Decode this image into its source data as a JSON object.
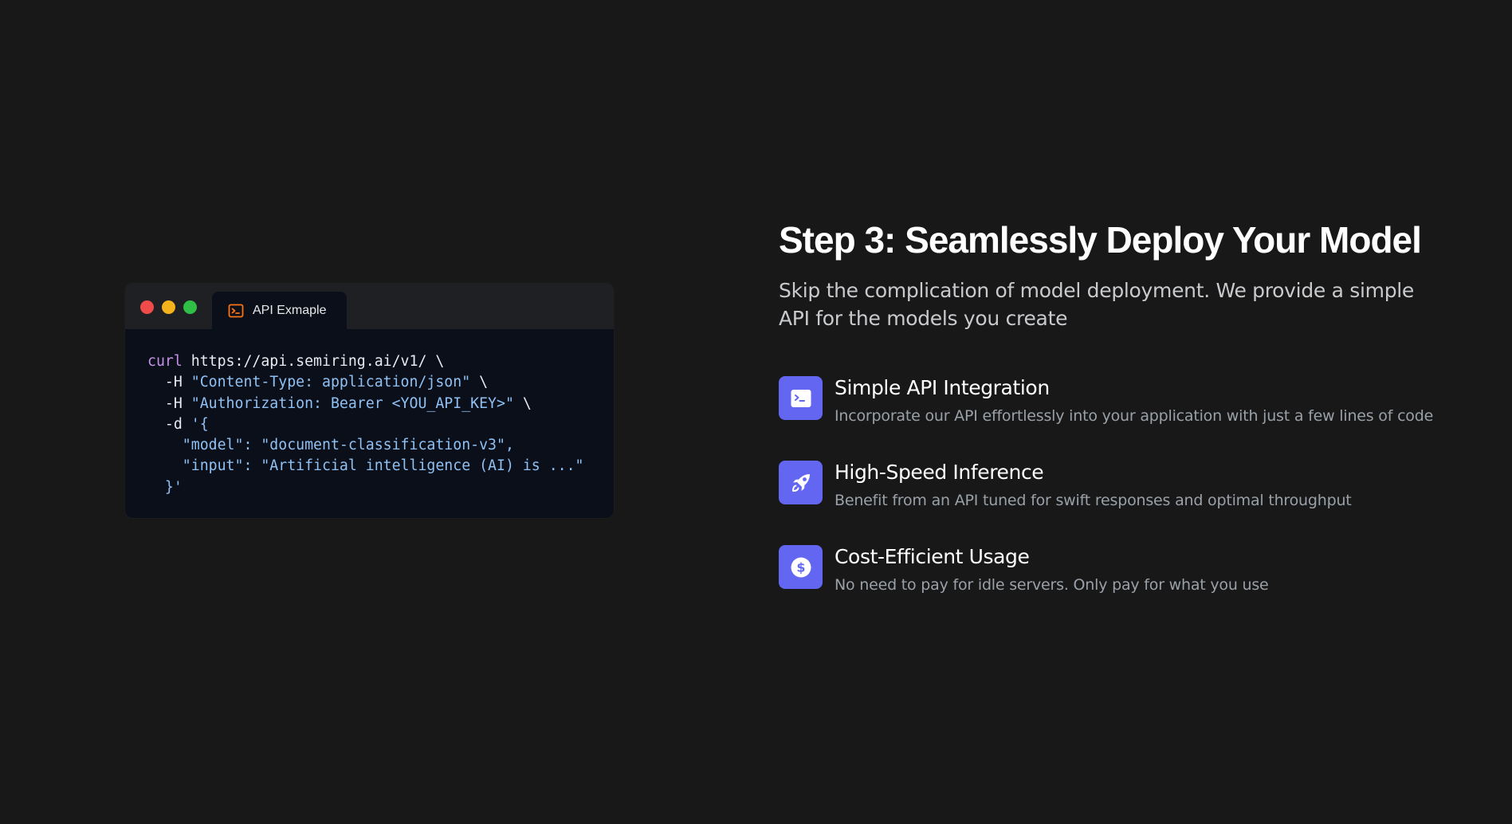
{
  "code_window": {
    "tab_label": "API Exmaple",
    "tab_icon": "terminal-icon",
    "traffic_lights": {
      "close": "#ef4b4b",
      "minimize": "#f4b21b",
      "maximize": "#2fbf46"
    },
    "code_lines": [
      [
        {
          "t": "kw",
          "v": "curl"
        },
        {
          "t": "plain",
          "v": " https://api.semiring.ai/v1/ \\"
        }
      ],
      [
        {
          "t": "plain",
          "v": "  -H "
        },
        {
          "t": "str",
          "v": "\"Content-Type: application/json\""
        },
        {
          "t": "plain",
          "v": " \\"
        }
      ],
      [
        {
          "t": "plain",
          "v": "  -H "
        },
        {
          "t": "str",
          "v": "\"Authorization: Bearer <YOU_API_KEY>\""
        },
        {
          "t": "plain",
          "v": " \\"
        }
      ],
      [
        {
          "t": "plain",
          "v": "  -d "
        },
        {
          "t": "str",
          "v": "'{"
        }
      ],
      [
        {
          "t": "str",
          "v": "    \"model\": \"document-classification-v3\","
        }
      ],
      [
        {
          "t": "str",
          "v": "    \"input\": \"Artificial intelligence (AI) is ...\""
        }
      ],
      [
        {
          "t": "str",
          "v": "  }'"
        }
      ]
    ]
  },
  "section": {
    "title": "Step 3: Seamlessly Deploy Your Model",
    "subtitle": "Skip the complication of model deployment. We provide a simple API for the models you create"
  },
  "features": [
    {
      "icon": "terminal-icon",
      "title": "Simple API Integration",
      "description": "Incorporate our API effortlessly into your application with just a few lines of code"
    },
    {
      "icon": "rocket-icon",
      "title": "High-Speed Inference",
      "description": "Benefit from an API tuned for swift responses and optimal throughput"
    },
    {
      "icon": "dollar-icon",
      "title": "Cost-Efficient Usage",
      "description": "No need to pay for idle servers. Only pay for what you use"
    }
  ],
  "colors": {
    "background": "#181818",
    "accent": "#6366f1",
    "code_keyword": "#c792ea",
    "code_string": "#8fc1f5",
    "tab_icon": "#f97316"
  }
}
